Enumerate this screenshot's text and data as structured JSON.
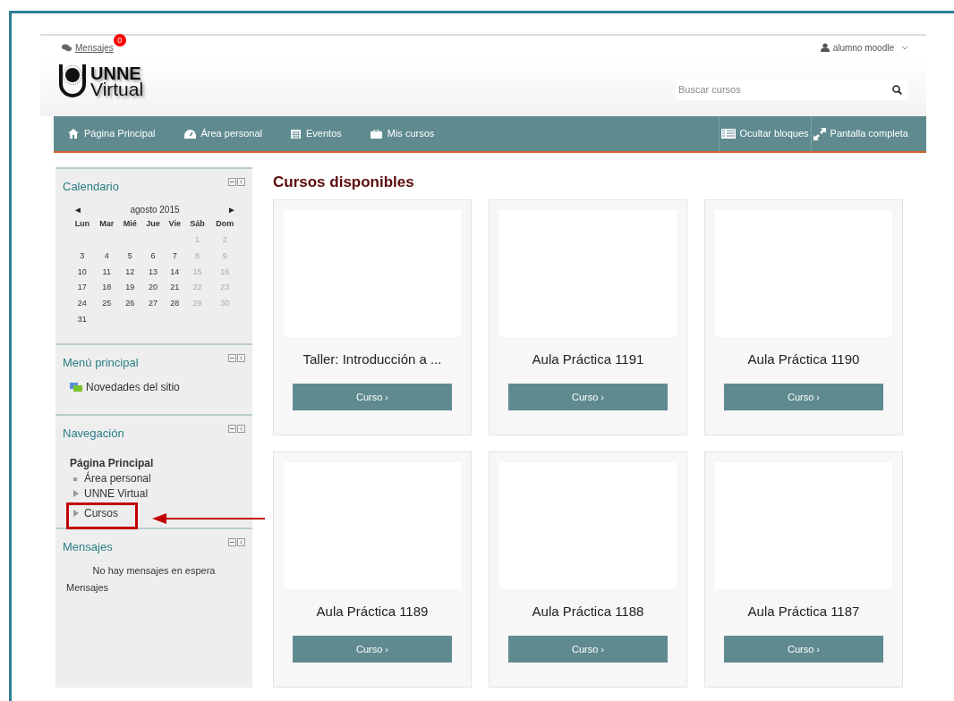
{
  "top_bar": {
    "messages_label": "Mensajes",
    "messages_badge": "0",
    "user_name": "alumno moodle"
  },
  "logo": {
    "line_1": "UNNE",
    "line_2": "Virtual"
  },
  "search": {
    "placeholder": "Buscar cursos"
  },
  "nav_menu": [
    "Página Principal",
    "Área personal",
    "Eventos",
    "Mis cursos"
  ],
  "nav_actions": [
    "Ocultar bloques",
    "Pantalla completa"
  ],
  "calendar": {
    "title": "Calendario",
    "month": "agosto 2015",
    "prev": "◄",
    "next": "►",
    "weekdays": [
      "Lun",
      "Mar",
      "Mié",
      "Jue",
      "Vie",
      "Sáb",
      "Dom"
    ],
    "weeks": [
      [
        "1",
        "2"
      ],
      [
        "3",
        "4",
        "5",
        "6",
        "7",
        "8",
        "9"
      ],
      [
        "10",
        "11",
        "12",
        "13",
        "14",
        "15",
        "16"
      ],
      [
        "17",
        "18",
        "19",
        "20",
        "21",
        "22",
        "23"
      ],
      [
        "24",
        "25",
        "26",
        "27",
        "28",
        "29",
        "30"
      ],
      [
        "31"
      ]
    ]
  },
  "main_menu": {
    "title": "Menú principal",
    "items": [
      "Novedades del sitio"
    ]
  },
  "navigation": {
    "title": "Navegación",
    "root": "Página Principal",
    "children": [
      {
        "label": "Área personal",
        "kind": "leaf",
        "highlighted": false
      },
      {
        "label": "UNNE Virtual",
        "kind": "branch",
        "highlighted": false
      },
      {
        "label": "Cursos",
        "kind": "branch",
        "highlighted": true
      }
    ]
  },
  "messages_block": {
    "title": "Mensajes",
    "empty_text": "No hay mensajes en espera",
    "link": "Mensajes"
  },
  "courses": {
    "title": "Cursos disponibles",
    "items": [
      {
        "name": "Taller: Introducción a ...",
        "button": "Curso ›"
      },
      {
        "name": "Aula Práctica 1191",
        "button": "Curso ›"
      },
      {
        "name": "Aula Práctica 1190",
        "button": "Curso ›"
      },
      {
        "name": "Aula Práctica 1189",
        "button": "Curso ›"
      },
      {
        "name": "Aula Práctica 1188",
        "button": "Curso ›"
      },
      {
        "name": "Aula Práctica 1187",
        "button": "Curso ›"
      }
    ]
  }
}
